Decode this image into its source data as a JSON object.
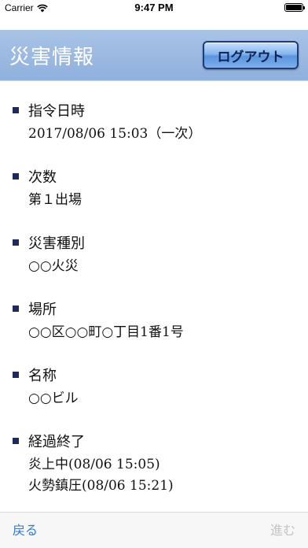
{
  "status_bar": {
    "carrier": "Carrier",
    "time": "9:47 PM",
    "battery_level": 1.0
  },
  "header": {
    "title": "災害情報",
    "logout_label": "ログアウト",
    "background_color": "#95b5e0"
  },
  "sections": [
    {
      "label": "指令日時",
      "lines": [
        "2017/08/06 15:03（一次）"
      ]
    },
    {
      "label": "次数",
      "lines": [
        "第１出場"
      ]
    },
    {
      "label": "災害種別",
      "lines": [
        "○○火災"
      ]
    },
    {
      "label": "場所",
      "lines": [
        "○○区○○町○丁目1番1号"
      ]
    },
    {
      "label": "名称",
      "lines": [
        "○○ビル"
      ]
    },
    {
      "label": "経過終了",
      "lines": [
        "炎上中(08/06 15:05)",
        "火勢鎮圧(08/06 15:21)"
      ]
    }
  ],
  "toolbar": {
    "back_label": "戻る",
    "next_label": "進む",
    "back_color": "#2a7ad7",
    "next_color": "#c4c4c4"
  }
}
